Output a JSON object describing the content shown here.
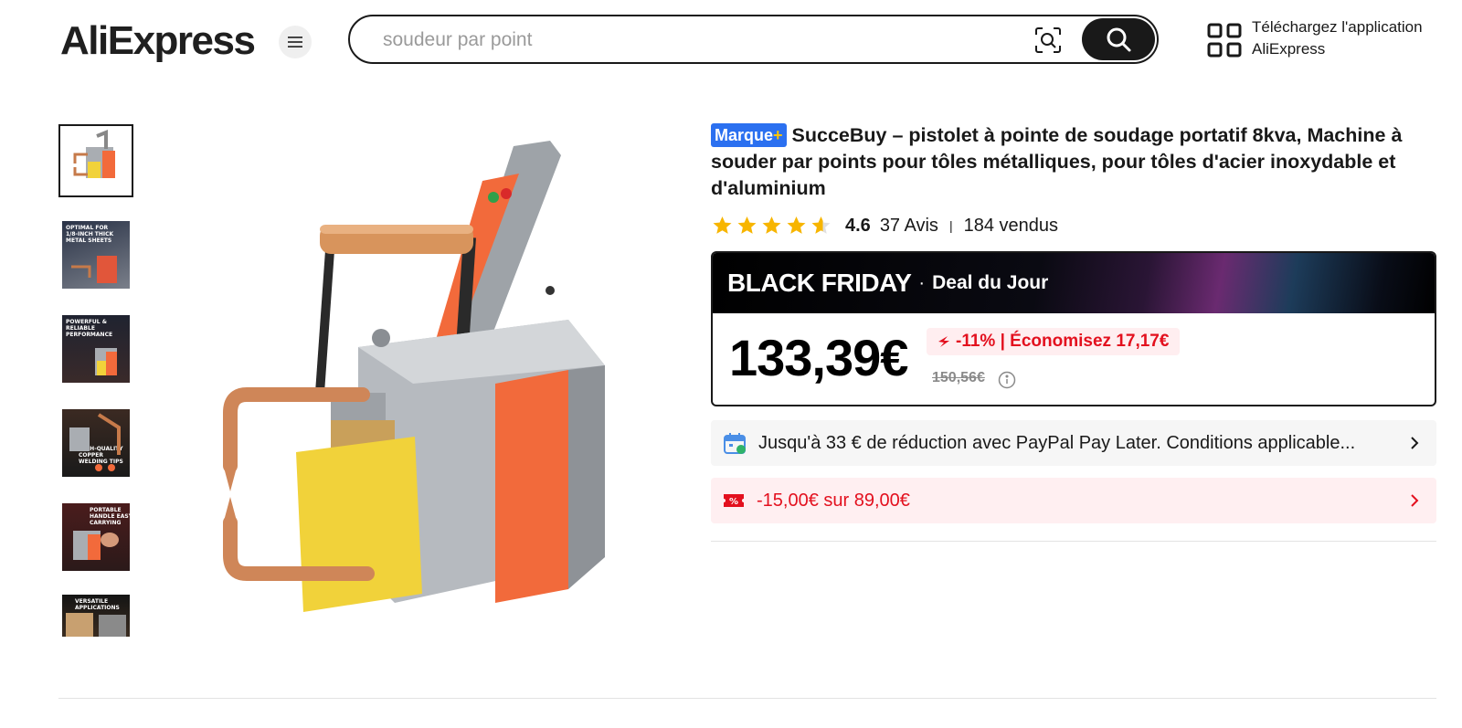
{
  "header": {
    "logo_text": "AliExpress",
    "search_placeholder": "soudeur par point",
    "app_download_line1": "Téléchargez l'application",
    "app_download_line2": "AliExpress"
  },
  "gallery": {
    "thumbnails": [
      {
        "caption": ""
      },
      {
        "caption": "OPTIMAL FOR 1/8-INCH THICK METAL SHEETS"
      },
      {
        "caption": "POWERFUL & RELIABLE PERFORMANCE"
      },
      {
        "caption": "HIGH-QUALITY COPPER WELDING TIPS"
      },
      {
        "caption": "PORTABLE HANDLE EASY CARRYING"
      },
      {
        "caption": "VERSATILE APPLICATIONS"
      }
    ]
  },
  "product": {
    "brand_badge": "Marque",
    "brand_badge_plus": "+",
    "title": "SucceBuy – pistolet à pointe de soudage portatif 8kva, Machine à souder par points pour tôles métalliques, pour tôles d'acier inoxydable et d'aluminium",
    "rating": "4.6",
    "rating_stars": 4.6,
    "reviews": "37 Avis",
    "sold": "184 vendus"
  },
  "price": {
    "banner_title": "BLACK FRIDAY",
    "banner_dot": "·",
    "banner_subtitle": "Deal du Jour",
    "current": "133,39€",
    "discount": "-11% | Économisez 17,17€",
    "original": "150,56€"
  },
  "promos": {
    "paypal": "Jusqu'à 33 € de réduction avec PayPal Pay Later. Conditions applicable...",
    "coupon": "-15,00€ sur 89,00€"
  },
  "colors": {
    "brand_blue": "#2b70f0",
    "sale_red": "#e3101e",
    "star_gold": "#f7b500",
    "machine_orange": "#f26a3b",
    "copper": "#d08a5c"
  },
  "icons": [
    "menu-icon",
    "camera-search-icon",
    "search-icon",
    "qr-code-icon",
    "star-icon",
    "flame-icon",
    "info-icon",
    "calendar-icon",
    "coupon-icon",
    "chevron-right-icon"
  ]
}
